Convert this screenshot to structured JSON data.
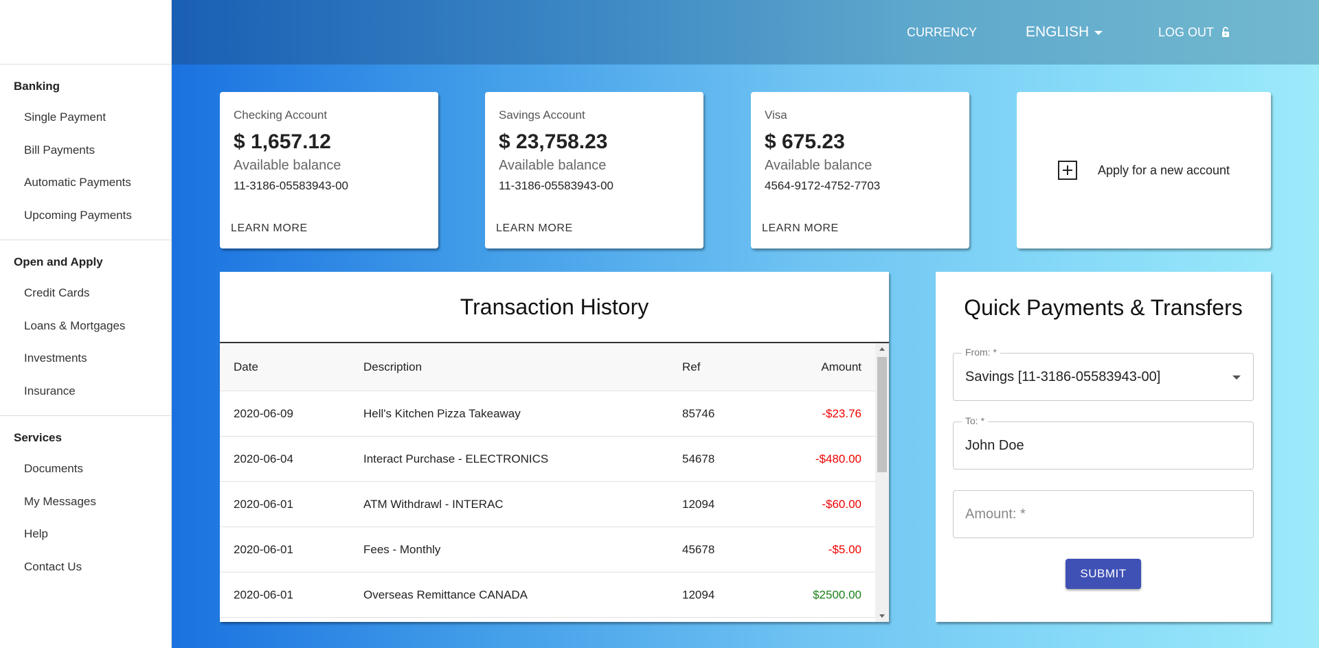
{
  "header": {
    "currency": "CURRENCY",
    "language": "ENGLISH",
    "logout": "LOG OUT"
  },
  "sidebar": {
    "sections": [
      {
        "heading": "Banking",
        "items": [
          "Single Payment",
          "Bill Payments",
          "Automatic Payments",
          "Upcoming Payments"
        ]
      },
      {
        "heading": "Open and Apply",
        "items": [
          "Credit Cards",
          "Loans & Mortgages",
          "Investments",
          "Insurance"
        ]
      },
      {
        "heading": "Services",
        "items": [
          "Documents",
          "My Messages",
          "Help",
          "Contact Us"
        ]
      }
    ]
  },
  "accounts": [
    {
      "name": "Checking Account",
      "amount": "$ 1,657.12",
      "available": "Available balance",
      "number": "11-3186-05583943-00",
      "learn_more": "LEARN MORE"
    },
    {
      "name": "Savings Account",
      "amount": "$ 23,758.23",
      "available": "Available balance",
      "number": "11-3186-05583943-00",
      "learn_more": "LEARN MORE"
    },
    {
      "name": "Visa",
      "amount": "$ 675.23",
      "available": "Available balance",
      "number": "4564-9172-4752-7703",
      "learn_more": "LEARN MORE"
    }
  ],
  "new_account": {
    "label": "Apply for a new account",
    "icon": "plus-square-icon"
  },
  "transactions": {
    "title": "Transaction History",
    "columns": {
      "date": "Date",
      "description": "Description",
      "ref": "Ref",
      "amount": "Amount"
    },
    "rows": [
      {
        "date": "2020-06-09",
        "description": "Hell's Kitchen Pizza Takeaway",
        "ref": "85746",
        "amount": "-$23.76",
        "sign": "neg"
      },
      {
        "date": "2020-06-04",
        "description": "Interact Purchase - ELECTRONICS",
        "ref": "54678",
        "amount": "-$480.00",
        "sign": "neg"
      },
      {
        "date": "2020-06-01",
        "description": "ATM Withdrawl - INTERAC",
        "ref": "12094",
        "amount": "-$60.00",
        "sign": "neg"
      },
      {
        "date": "2020-06-01",
        "description": "Fees - Monthly",
        "ref": "45678",
        "amount": "-$5.00",
        "sign": "neg"
      },
      {
        "date": "2020-06-01",
        "description": "Overseas Remittance CANADA",
        "ref": "12094",
        "amount": "$2500.00",
        "sign": "pos"
      }
    ]
  },
  "quick_payments": {
    "title": "Quick Payments & Transfers",
    "from_label": "From: *",
    "from_value": "Savings [11-3186-05583943-00]",
    "to_label": "To: *",
    "to_value": "John Doe",
    "amount_placeholder": "Amount: *",
    "submit": "SUBMIT"
  },
  "colors": {
    "negative": "#ee0000",
    "positive": "#1a7f1a",
    "submit_button": "#3f51b5"
  }
}
